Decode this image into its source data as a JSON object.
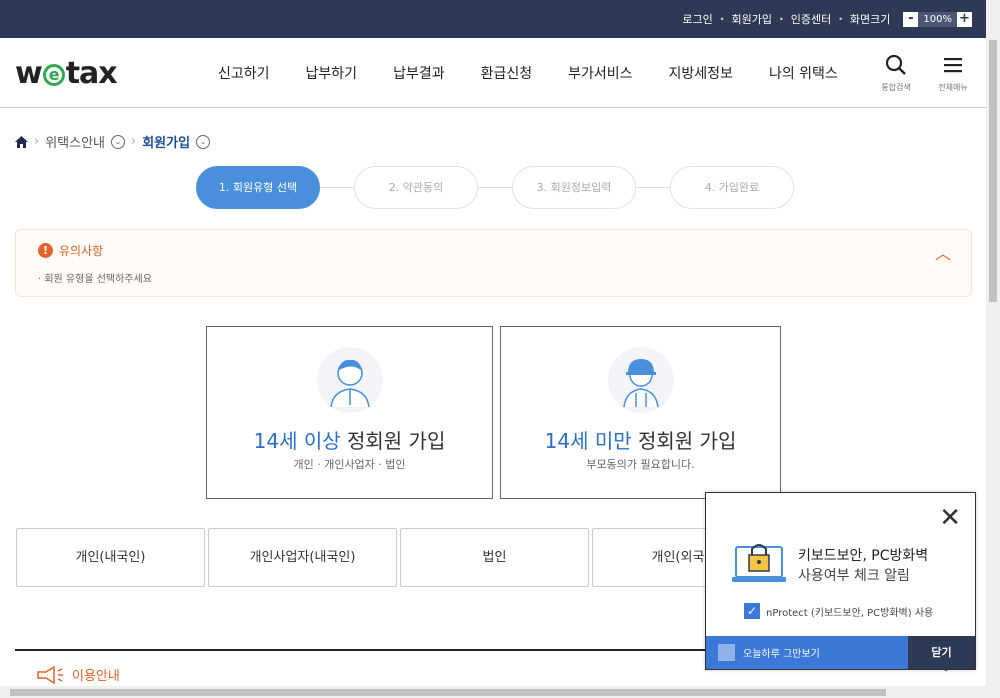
{
  "topbar": {
    "login": "로그인",
    "signup": "회원가입",
    "cert_center": "인증센터",
    "screen_size": "화면크기",
    "zoom_minus": "-",
    "zoom_value": "100%",
    "zoom_plus": "+"
  },
  "logo": {
    "pre": "w",
    "e": "e",
    "post": "tax"
  },
  "gnb": [
    "신고하기",
    "납부하기",
    "납부결과",
    "환급신청",
    "부가서비스",
    "지방세정보",
    "나의 위택스"
  ],
  "header_icons": {
    "search_label": "통합검색",
    "menu_label": "전체메뉴"
  },
  "breadcrumb": {
    "level1": "위택스안내",
    "level2": "회원가입"
  },
  "steps": [
    "1. 회원유형 선택",
    "2. 약관동의",
    "3. 회원정보입력",
    "4. 가입완료"
  ],
  "notice": {
    "title": "유의사항",
    "desc": "· 회원 유형을 선택하주세요"
  },
  "cards": {
    "adult": {
      "highlight": "14세 이상",
      "rest": " 정회원 가입",
      "sub": "개인 · 개인사업자 · 법인"
    },
    "minor": {
      "highlight": "14세 미만",
      "rest": " 정회원 가입",
      "sub": "부모동의가 필요합니다."
    }
  },
  "tabs": [
    "개인(내국인)",
    "개인사업자(내국인)",
    "법인",
    "개인(외국인)"
  ],
  "guide": {
    "title": "이용안내"
  },
  "popup": {
    "title": "키보드보안, PC방화벽",
    "subtitle": "사용여부 체크 알림",
    "check_label": "nProtect (키보드보안, PC방화벽) 사용",
    "dont_show": "오늘하루 그만보기",
    "close_btn": "닫기"
  },
  "colors": {
    "navy": "#2e3a55",
    "accent_blue": "#4a8fdc",
    "orange": "#e0642c",
    "green": "#2fa84f"
  }
}
